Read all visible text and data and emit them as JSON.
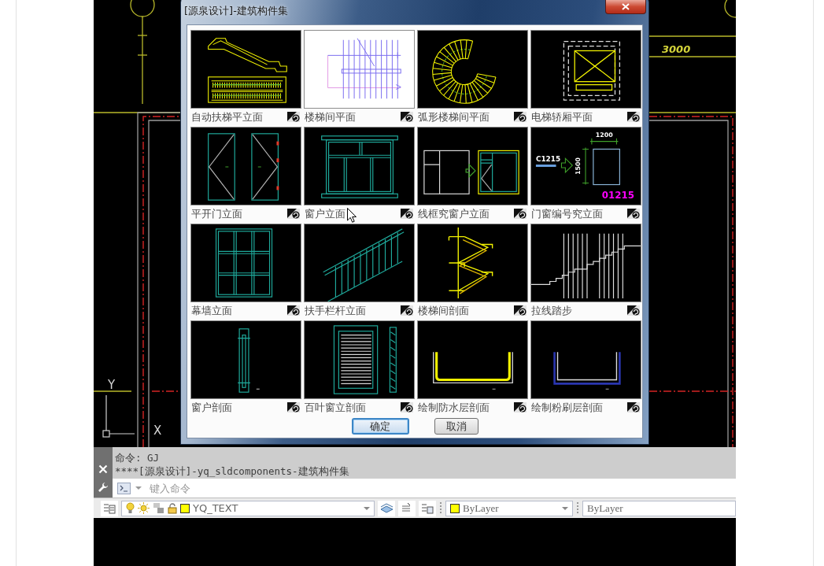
{
  "cad": {
    "dimension_text": "3000",
    "ucs": {
      "y_label": "Y",
      "x_label": "X"
    }
  },
  "dialog": {
    "title": "[源泉设计]-建筑构件集",
    "tiles": [
      {
        "label": "自动扶梯平立面",
        "kind": "escalator",
        "selected": false
      },
      {
        "label": "楼梯间平面",
        "kind": "stair-plan",
        "selected": true
      },
      {
        "label": "弧形楼梯间平面",
        "kind": "spiral-stair",
        "selected": false
      },
      {
        "label": "电梯轿厢平面",
        "kind": "elevator-car",
        "selected": false
      },
      {
        "label": "平开门立面",
        "kind": "swing-door",
        "selected": false
      },
      {
        "label": "窗户立面",
        "kind": "window",
        "selected": false
      },
      {
        "label": "线框究窗户立面",
        "kind": "frame-window",
        "selected": false
      },
      {
        "label": "门窗编号究立面",
        "kind": "window-tag",
        "selected": false,
        "texts": [
          "1200",
          "1500",
          "C1215",
          "01215"
        ]
      },
      {
        "label": "幕墙立面",
        "kind": "curtain-wall",
        "selected": false
      },
      {
        "label": "扶手栏杆立面",
        "kind": "railing",
        "selected": false
      },
      {
        "label": "楼梯间剖面",
        "kind": "stair-section",
        "selected": false
      },
      {
        "label": "拉线踏步",
        "kind": "stepped-line",
        "selected": false
      },
      {
        "label": "窗户剖面",
        "kind": "window-section",
        "selected": false
      },
      {
        "label": "百叶窗立剖面",
        "kind": "louver",
        "selected": false
      },
      {
        "label": "绘制防水层剖面",
        "kind": "waterproof",
        "selected": false
      },
      {
        "label": "绘制粉刷层剖面",
        "kind": "plaster",
        "selected": false
      }
    ],
    "buttons": [
      {
        "label": "确定",
        "default": true
      },
      {
        "label": "取消",
        "default": false
      }
    ]
  },
  "command_panel": {
    "history": [
      "命令: GJ",
      "****[源泉设计]-yq_sldcomponents-建筑构件集"
    ],
    "input": {
      "placeholder": "键入命令"
    }
  },
  "properties_toolbar": {
    "layer": "YQ_TEXT",
    "color_setting": "ByLayer",
    "linetype": "ByLayer"
  }
}
